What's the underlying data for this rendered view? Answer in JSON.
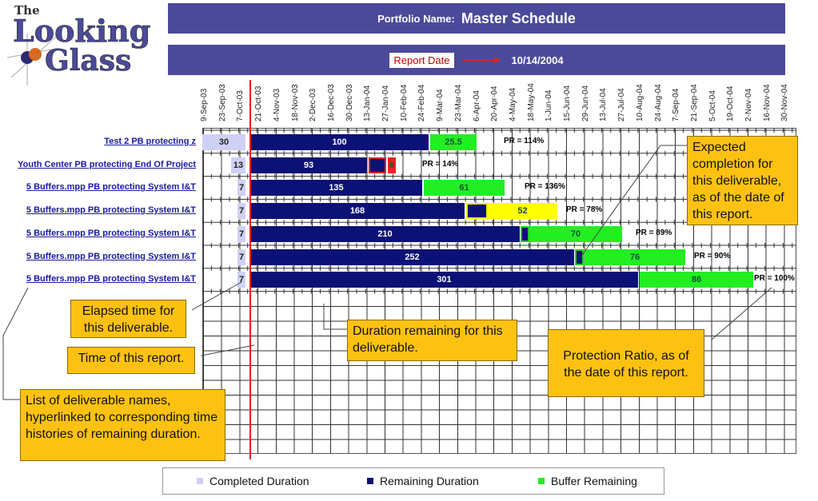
{
  "logo": {
    "text_line1": "The",
    "text_line2": "Looking",
    "text_line3": "Glass"
  },
  "header": {
    "portfolio_label": "Portfolio Name:",
    "portfolio_name": "Master Schedule",
    "report_date_label": "Report Date",
    "report_date": "10/14/2004"
  },
  "chart_data": {
    "type": "bar",
    "orientation": "horizontal-gantt",
    "x_ticks": [
      "9-Sep-03",
      "23-Sep-03",
      "7-Oct-03",
      "21-Oct-03",
      "4-Nov-03",
      "18-Nov-03",
      "2-Dec-03",
      "16-Dec-03",
      "30-Dec-03",
      "13-Jan-04",
      "27-Jan-04",
      "10-Feb-04",
      "24-Feb-04",
      "9-Mar-04",
      "23-Mar-04",
      "6-Apr-04",
      "20-Apr-04",
      "4-May-04",
      "18-May-04",
      "1-Jun-04",
      "15-Jun-04",
      "29-Jun-04",
      "13-Jul-04",
      "27-Jul-04",
      "10-Aug-04",
      "24-Aug-04",
      "7-Sep-04",
      "21-Sep-04",
      "5-Oct-04",
      "19-Oct-04",
      "2-Nov-04",
      "16-Nov-04",
      "30-Nov-04"
    ],
    "grid": true,
    "rows": [
      {
        "name": "Test 2 PB protecting z",
        "completed": "30",
        "remaining": "100",
        "buffer": "25.5",
        "pr": "PR = 114%",
        "buffer_color": "#22ee22"
      },
      {
        "name": "Youth Center PB protecting End Of Project",
        "completed": "13",
        "remaining": "93",
        "buffer": "6",
        "pr": "PR = 14%",
        "buffer_color": "#ee2222"
      },
      {
        "name": "5 Buffers.mpp PB protecting System I&T",
        "completed": "7",
        "remaining": "135",
        "buffer": "61",
        "pr": "PR = 136%",
        "buffer_color": "#22ee22"
      },
      {
        "name": "5 Buffers.mpp PB protecting System I&T",
        "completed": "7",
        "remaining": "168",
        "buffer": "52",
        "pr": "PR = 78%",
        "buffer_color": "#ffff00"
      },
      {
        "name": "5 Buffers.mpp PB protecting System I&T",
        "completed": "7",
        "remaining": "210",
        "buffer": "70",
        "pr": "PR = 89%",
        "buffer_color": "#22ee22"
      },
      {
        "name": "5 Buffers.mpp PB protecting System I&T",
        "completed": "7",
        "remaining": "252",
        "buffer": "76",
        "pr": "PR = 90%",
        "buffer_color": "#22ee22"
      },
      {
        "name": "5 Buffers.mpp PB protecting System I&T",
        "completed": "7",
        "remaining": "301",
        "buffer": "86",
        "pr": "PR = 100%",
        "buffer_color": "#22ee22"
      }
    ],
    "legend": [
      {
        "label": "Completed Duration",
        "color": "#cfd0f5"
      },
      {
        "label": "Remaining Duration",
        "color": "#0c1177"
      },
      {
        "label": "Buffer Remaining",
        "color": "#22ee22"
      }
    ],
    "report_line_color": "#dd2222"
  },
  "callouts": {
    "expected": "Expected completion for this deliverable, as of the date of this report.",
    "elapsed": "Elapsed time for this deliverable.",
    "duration": "Duration remaining for this deliverable.",
    "time": "Time of this report.",
    "protection": "Protection Ratio, as of the date of this report.",
    "list": "List of deliverable names, hyperlinked to corresponding time histories of remaining duration."
  }
}
